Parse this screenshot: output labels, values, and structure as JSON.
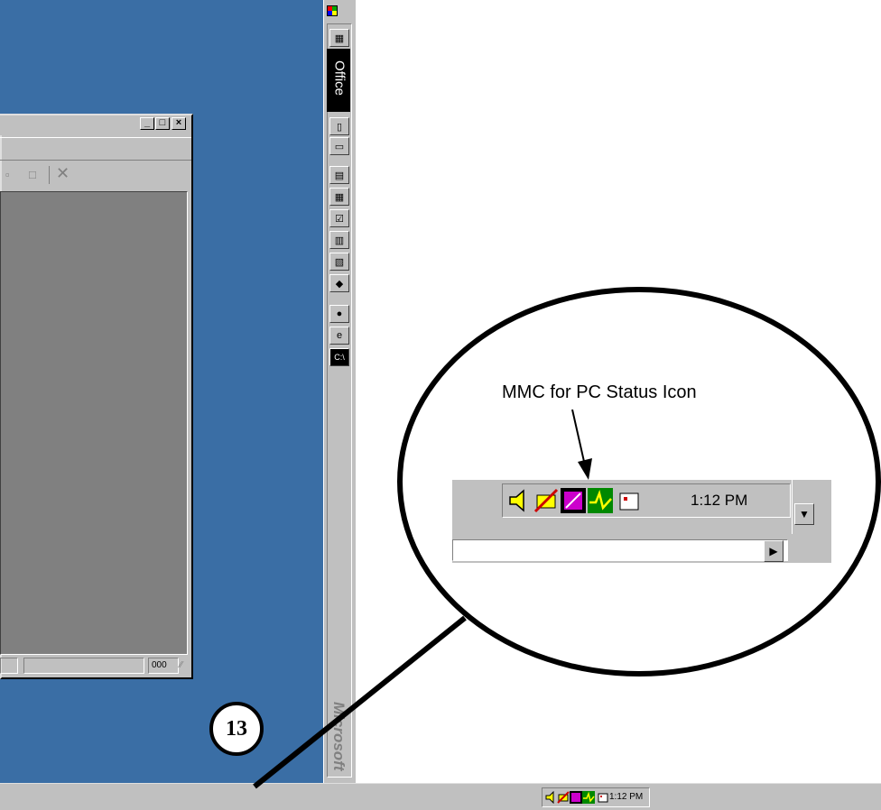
{
  "office_bar": {
    "title": "Office",
    "brand": "Microsoft",
    "buttons": [
      "office-icon",
      "new-document-icon",
      "open-folder-icon",
      "new-office-document-icon",
      "calendar-icon",
      "task-icon",
      "contact-icon",
      "journal-icon",
      "note-icon",
      "msn-icon",
      "internet-explorer-icon",
      "command-prompt-icon"
    ]
  },
  "window": {
    "status_cell": "000"
  },
  "tray": {
    "clock": "1:12 PM",
    "icons": [
      "speaker-icon",
      "network-icon",
      "mmc-pc-status-icon",
      "monitor-icon",
      "printer-icon"
    ]
  },
  "callout": {
    "label": "MMC for PC Status Icon",
    "clock": "1:12 PM"
  },
  "step_number": "13",
  "colors": {
    "desktop": "#3a6ea5",
    "face": "#c0c0c0",
    "office_title_bg": "#000000"
  }
}
